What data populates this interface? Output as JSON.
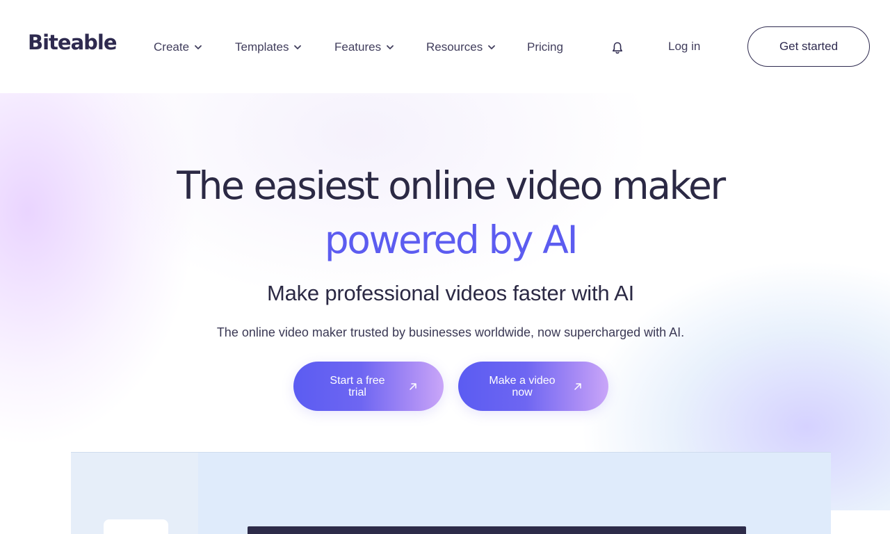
{
  "header": {
    "logo": "Biteable",
    "nav": [
      {
        "label": "Create",
        "has_dropdown": true
      },
      {
        "label": "Templates",
        "has_dropdown": true
      },
      {
        "label": "Features",
        "has_dropdown": true
      },
      {
        "label": "Resources",
        "has_dropdown": true
      },
      {
        "label": "Pricing",
        "has_dropdown": false
      }
    ],
    "notification_icon": "bell-icon",
    "login": "Log in",
    "get_started": "Get started"
  },
  "hero": {
    "headline_line1": "The easiest online video maker",
    "headline_line2": "powered by AI",
    "subheadline": "Make professional videos faster with AI",
    "description": "The online video maker trusted by businesses worldwide, now supercharged with AI.",
    "cta_primary": {
      "line1": "Start a free",
      "line2": "trial",
      "icon": "arrow-up-right-icon"
    },
    "cta_secondary": {
      "line1": "Make a video",
      "line2": "now",
      "icon": "arrow-up-right-icon"
    }
  },
  "colors": {
    "brand_dark": "#2e2a4f",
    "accent_purple": "#5c5cf0",
    "cta_gradient_start": "#5b5cf2",
    "cta_gradient_end": "#c9a6f8"
  }
}
